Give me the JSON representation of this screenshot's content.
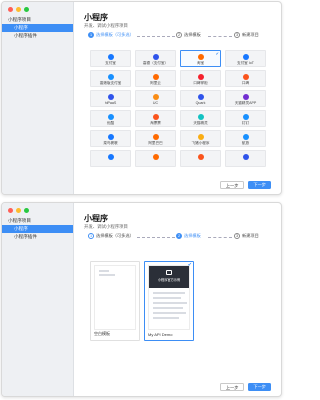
{
  "sidebar": {
    "items": [
      {
        "label": "小程序项目"
      },
      {
        "label": "小程序"
      },
      {
        "label": "小程序插件"
      }
    ]
  },
  "page": {
    "title": "小程序",
    "subtitle": "开发、调试小程序项目"
  },
  "steps": [
    {
      "num": "1",
      "label": "选择模板（可多选）"
    },
    {
      "num": "2",
      "label": "选择模板"
    },
    {
      "num": "3",
      "label": "新建项目"
    }
  ],
  "templates": [
    {
      "name": "支付宝",
      "color": "#1677ff"
    },
    {
      "name": "高德（支付宝）",
      "color": "#2f54eb"
    },
    {
      "name": "淘宝",
      "color": "#ff6a00",
      "selected": true
    },
    {
      "name": "支付宝 IoT",
      "color": "#1677ff"
    },
    {
      "name": "香港版支付宝",
      "color": "#1890ff"
    },
    {
      "name": "阿里云",
      "color": "#ff6a00"
    },
    {
      "name": "口碑掌柜",
      "color": "#f5222d"
    },
    {
      "name": "口碑",
      "color": "#fa541c"
    },
    {
      "name": "hiPaaS",
      "color": "#2f54eb"
    },
    {
      "name": "UC",
      "color": "#fa8c16"
    },
    {
      "name": "Quark",
      "color": "#2f54eb"
    },
    {
      "name": "天猫精灵APP",
      "color": "#722ed1"
    },
    {
      "name": "优酷",
      "color": "#1890ff"
    },
    {
      "name": "淘票票",
      "color": "#fa541c"
    },
    {
      "name": "天猫精灵",
      "color": "#13c2c2"
    },
    {
      "name": "钉钉",
      "color": "#1890ff"
    },
    {
      "name": "菜鸟裹裹",
      "color": "#1677ff"
    },
    {
      "name": "阿里巴巴",
      "color": "#ff6a00"
    },
    {
      "name": "飞猪小程序",
      "color": "#faad14"
    },
    {
      "name": "航旅",
      "color": "#1890ff"
    },
    {
      "name": "",
      "color": "#1677ff"
    },
    {
      "name": "",
      "color": "#ff6a00"
    },
    {
      "name": "",
      "color": "#fa541c"
    },
    {
      "name": "",
      "color": "#2f54eb"
    }
  ],
  "buttons": {
    "prev": "上一步",
    "next": "下一步"
  },
  "step2": {
    "cards": [
      {
        "name": "空白模板"
      },
      {
        "name": "My API Demo",
        "hero": "小程序官方示例",
        "selected": true
      }
    ]
  },
  "colors": {
    "accent": "#3d8ef5"
  }
}
